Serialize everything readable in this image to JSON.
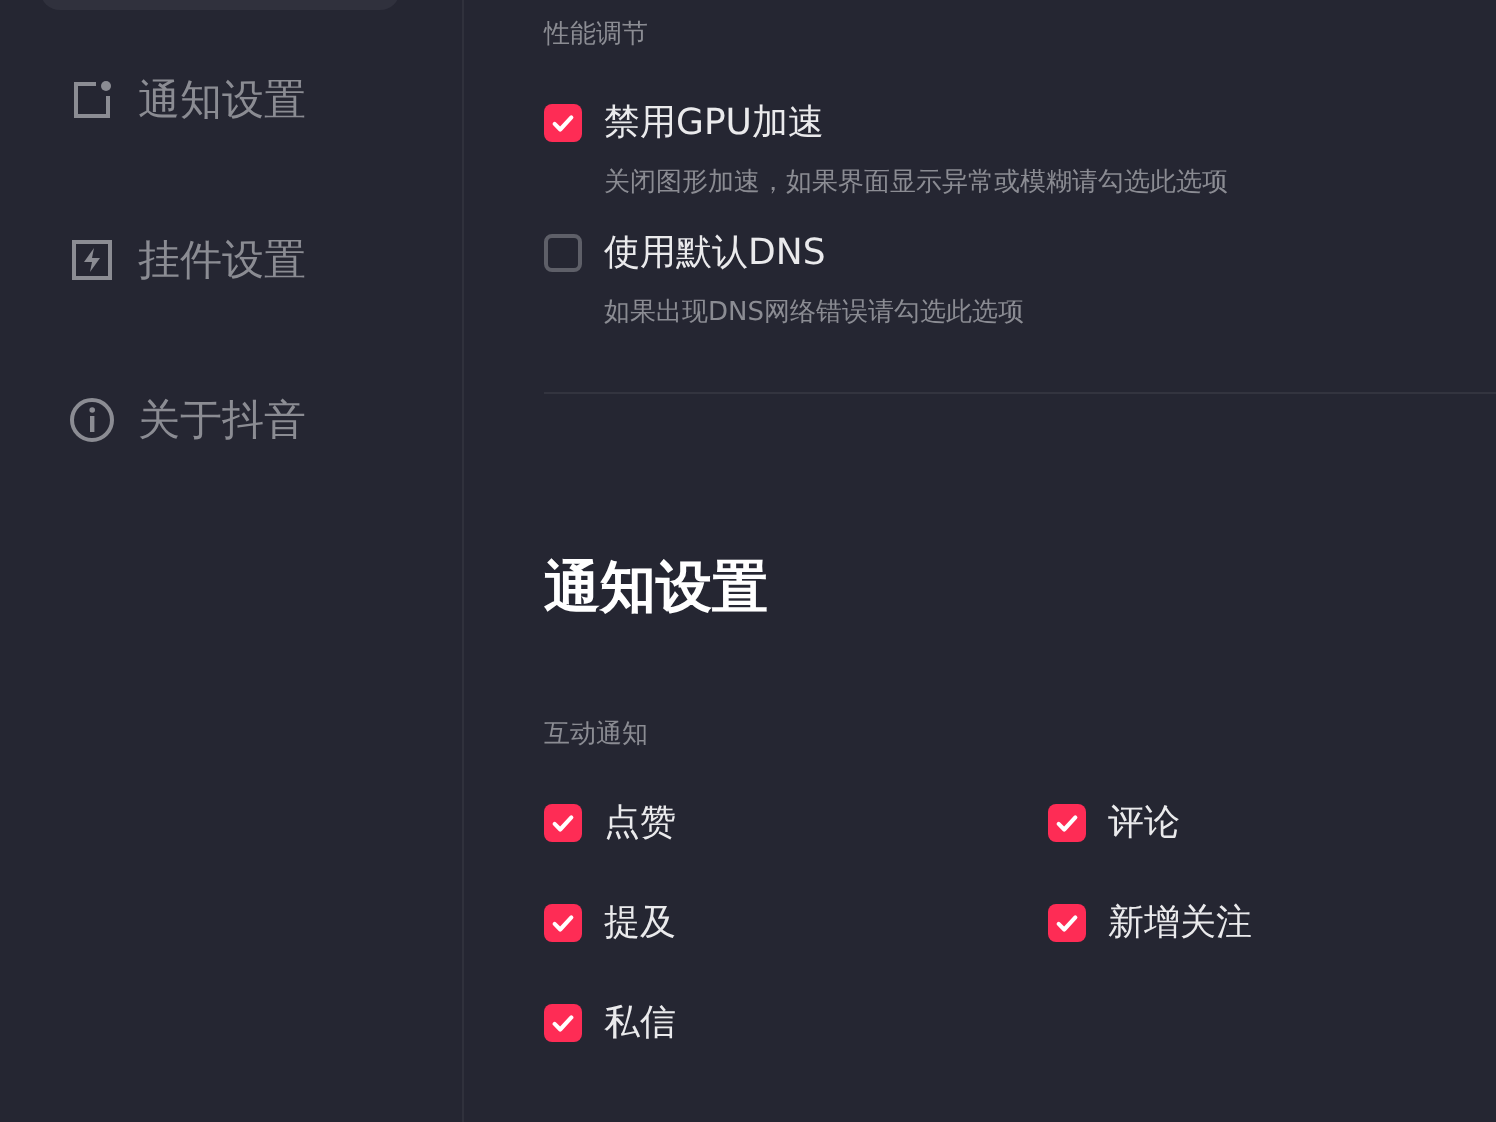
{
  "sidebar": {
    "items": [
      {
        "label": "通知设置",
        "kind": "notification",
        "selected": false
      },
      {
        "label": "挂件设置",
        "kind": "widget",
        "selected": false
      },
      {
        "label": "关于抖音",
        "kind": "info",
        "selected": false
      }
    ]
  },
  "performance": {
    "title": "性能调节",
    "options": [
      {
        "label": "禁用GPU加速",
        "description": "关闭图形加速，如果界面显示异常或模糊请勾选此选项",
        "checked": true
      },
      {
        "label": "使用默认DNS",
        "description": "如果出现DNS网络错误请勾选此选项",
        "checked": false
      }
    ]
  },
  "notifications": {
    "heading": "通知设置",
    "group_title": "互动通知",
    "options": [
      {
        "label": "点赞",
        "checked": true
      },
      {
        "label": "评论",
        "checked": true
      },
      {
        "label": "提及",
        "checked": true
      },
      {
        "label": "新增关注",
        "checked": true
      },
      {
        "label": "私信",
        "checked": true
      }
    ]
  }
}
